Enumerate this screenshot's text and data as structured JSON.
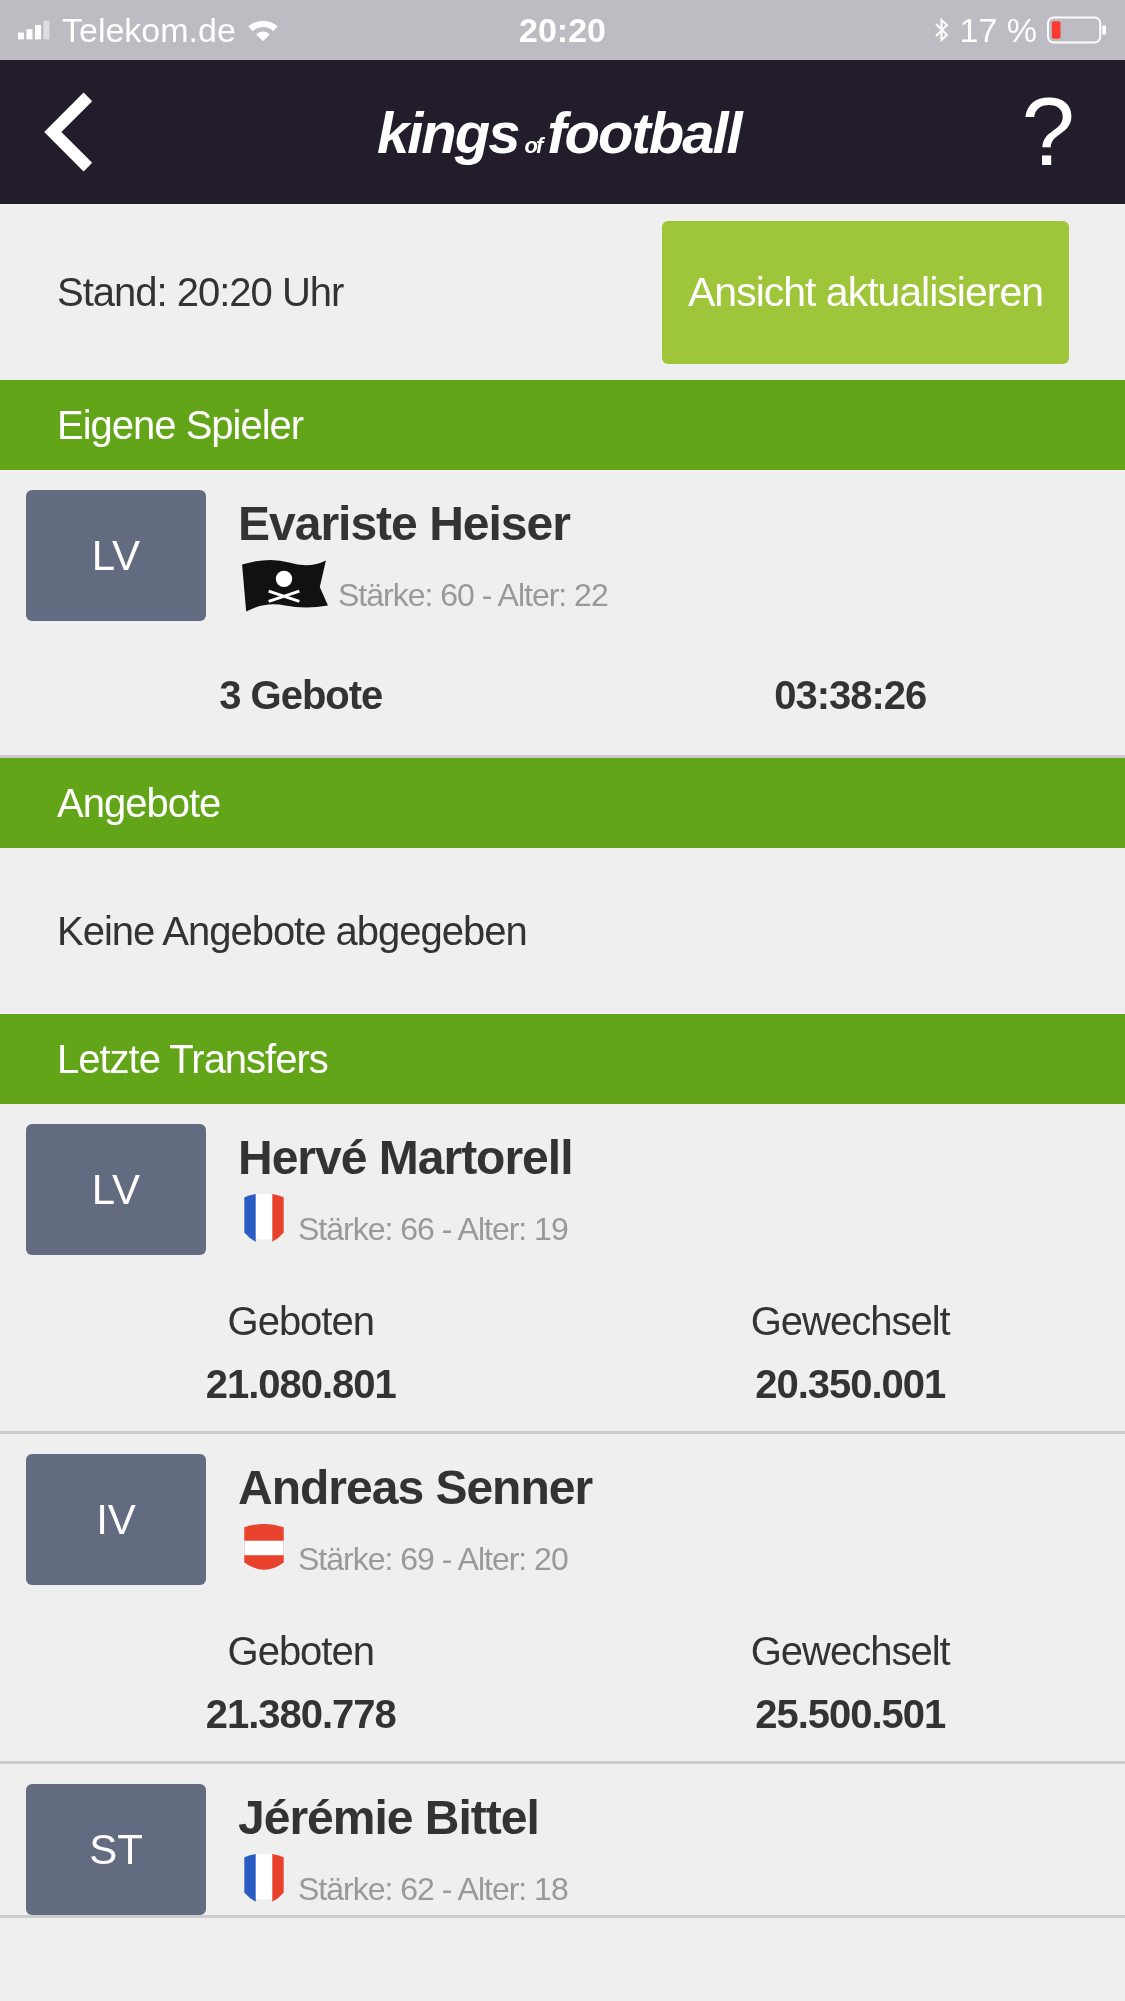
{
  "status_bar": {
    "carrier": "Telekom.de",
    "time": "20:20",
    "battery_text": "17 %"
  },
  "header": {
    "logo": {
      "part_1": "kings",
      "part_2": "of",
      "part_3": "football"
    },
    "help": "?"
  },
  "stand": {
    "text": "Stand: 20:20 Uhr",
    "button": "Ansicht aktualisieren"
  },
  "own_players": {
    "title": "Eigene Spieler",
    "players": [
      {
        "position": "LV",
        "name": "Evariste Heiser",
        "kind": "pirate",
        "info": "Stärke: 60 - Alter: 22",
        "bids": "3 Gebote",
        "time": "03:38:26"
      }
    ]
  },
  "offers": {
    "title": "Angebote",
    "empty": "Keine Angebote abgegeben"
  },
  "transfers": {
    "title": "Letzte Transfers",
    "rows": [
      {
        "position": "LV",
        "name": "Hervé Martorell",
        "kind": "france",
        "info": "Stärke: 66 - Alter: 19",
        "bid_label": "Geboten",
        "bid": "21.080.801",
        "switch_label": "Gewechselt",
        "switch": "20.350.001"
      },
      {
        "position": "IV",
        "name": "Andreas Senner",
        "kind": "austria",
        "info": "Stärke: 69 - Alter: 20",
        "bid_label": "Geboten",
        "bid": "21.380.778",
        "switch_label": "Gewechselt",
        "switch": "25.500.501"
      },
      {
        "position": "ST",
        "name": "Jérémie Bittel",
        "kind": "france",
        "info": "Stärke: 62 - Alter: 18"
      }
    ]
  }
}
